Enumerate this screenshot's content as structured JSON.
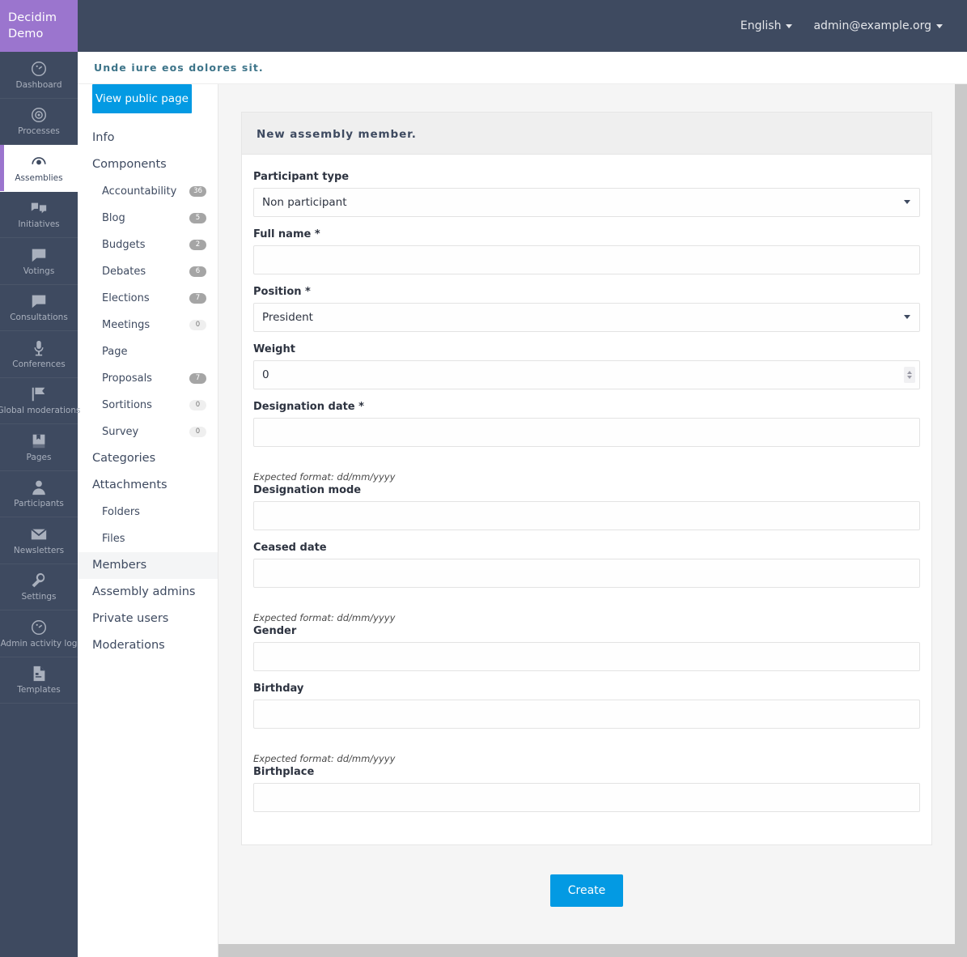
{
  "brand": {
    "line1": "Decidim",
    "line2": "Demo",
    "color": "#9b75ce"
  },
  "topbar": {
    "language": "English",
    "account": "admin@example.org"
  },
  "breadcrumb": {
    "text": "Unde iure eos dolores sit.",
    "color": "#3d7489"
  },
  "primary_nav": [
    {
      "label": "Dashboard",
      "icon": "dashboard-icon",
      "active": false
    },
    {
      "label": "Processes",
      "icon": "processes-icon",
      "active": false
    },
    {
      "label": "Assemblies",
      "icon": "assemblies-icon",
      "active": true
    },
    {
      "label": "Initiatives",
      "icon": "initiatives-icon",
      "active": false
    },
    {
      "label": "Votings",
      "icon": "votings-icon",
      "active": false
    },
    {
      "label": "Consultations",
      "icon": "consultations-icon",
      "active": false
    },
    {
      "label": "Conferences",
      "icon": "conferences-icon",
      "active": false
    },
    {
      "label": "Global moderations",
      "icon": "global-moderations-icon",
      "active": false
    },
    {
      "label": "Pages",
      "icon": "pages-icon",
      "active": false
    },
    {
      "label": "Participants",
      "icon": "participants-icon",
      "active": false
    },
    {
      "label": "Newsletters",
      "icon": "newsletters-icon",
      "active": false
    },
    {
      "label": "Settings",
      "icon": "settings-icon",
      "active": false
    },
    {
      "label": "Admin activity log",
      "icon": "admin-activity-log-icon",
      "active": false
    },
    {
      "label": "Templates",
      "icon": "templates-icon",
      "active": false
    }
  ],
  "secondary_nav": {
    "view_public_page": "View public page",
    "items": [
      {
        "label": "Info",
        "level": "top",
        "badge": null,
        "active": false
      },
      {
        "label": "Components",
        "level": "top",
        "badge": null,
        "active": false
      },
      {
        "label": "Accountability",
        "level": "sub",
        "badge": "36",
        "active": false
      },
      {
        "label": "Blog",
        "level": "sub",
        "badge": "5",
        "active": false
      },
      {
        "label": "Budgets",
        "level": "sub",
        "badge": "2",
        "active": false
      },
      {
        "label": "Debates",
        "level": "sub",
        "badge": "6",
        "active": false
      },
      {
        "label": "Elections",
        "level": "sub",
        "badge": "7",
        "active": false
      },
      {
        "label": "Meetings",
        "level": "sub",
        "badge": "0",
        "active": false
      },
      {
        "label": "Page",
        "level": "sub",
        "badge": null,
        "active": false
      },
      {
        "label": "Proposals",
        "level": "sub",
        "badge": "7",
        "active": false
      },
      {
        "label": "Sortitions",
        "level": "sub",
        "badge": "0",
        "active": false
      },
      {
        "label": "Survey",
        "level": "sub",
        "badge": "0",
        "active": false
      },
      {
        "label": "Categories",
        "level": "top",
        "badge": null,
        "active": false
      },
      {
        "label": "Attachments",
        "level": "top",
        "badge": null,
        "active": false
      },
      {
        "label": "Folders",
        "level": "sub",
        "badge": null,
        "active": false
      },
      {
        "label": "Files",
        "level": "sub",
        "badge": null,
        "active": false
      },
      {
        "label": "Members",
        "level": "top",
        "badge": null,
        "active": true
      },
      {
        "label": "Assembly admins",
        "level": "top",
        "badge": null,
        "active": false
      },
      {
        "label": "Private users",
        "level": "top",
        "badge": null,
        "active": false
      },
      {
        "label": "Moderations",
        "level": "top",
        "badge": null,
        "active": false
      }
    ]
  },
  "form": {
    "title": "New assembly member.",
    "participant_type": {
      "label": "Participant type",
      "value": "Non participant",
      "options": [
        "Non participant"
      ]
    },
    "full_name": {
      "label": "Full name",
      "required": "*",
      "value": "",
      "placeholder": ""
    },
    "position": {
      "label": "Position",
      "required": "*",
      "value": "President",
      "options": [
        "President"
      ]
    },
    "weight": {
      "label": "Weight",
      "value": "0"
    },
    "designation_date": {
      "label": "Designation date",
      "required": "*",
      "value": "",
      "hint": "Expected format: dd/mm/yyyy"
    },
    "designation_mode": {
      "label": "Designation mode",
      "value": ""
    },
    "ceased_date": {
      "label": "Ceased date",
      "value": "",
      "hint": "Expected format: dd/mm/yyyy"
    },
    "gender": {
      "label": "Gender",
      "value": ""
    },
    "birthday": {
      "label": "Birthday",
      "value": "",
      "hint": "Expected format: dd/mm/yyyy"
    },
    "birthplace": {
      "label": "Birthplace",
      "value": ""
    },
    "submit": "Create"
  },
  "colors": {
    "accent_blue": "#039ae3",
    "nav_dark": "#3e4a60",
    "brand_purple": "#9b75ce",
    "breadcrumb_teal": "#3d7489"
  }
}
